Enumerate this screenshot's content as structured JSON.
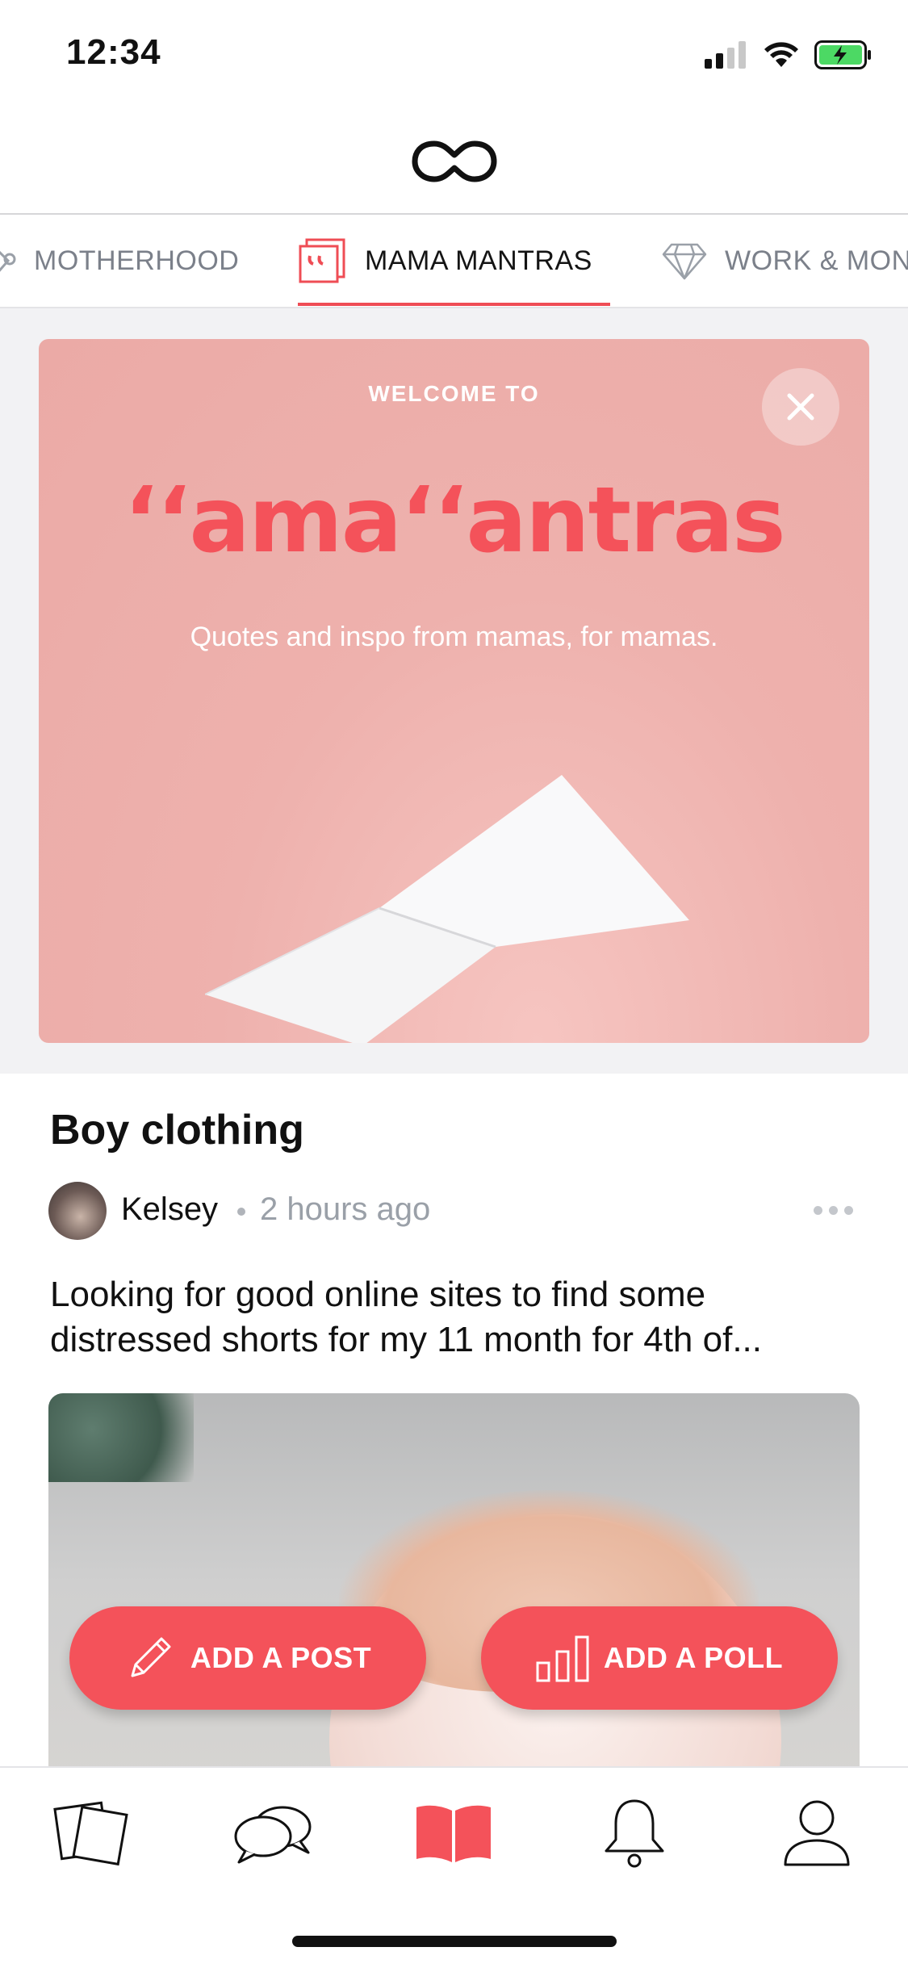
{
  "status_bar": {
    "time": "12:34"
  },
  "tabs": [
    {
      "label": "MOTHERHOOD",
      "icon": "baby-rattle-icon"
    },
    {
      "label": "MAMA MANTRAS",
      "icon": "quote-icon",
      "active": true
    },
    {
      "label": "WORK & MON",
      "icon": "diamond-icon"
    }
  ],
  "banner": {
    "welcome": "WELCOME TO",
    "brand": "ʻʻamaʻʻantras",
    "tagline": "Quotes and inspo from mamas, for mamas."
  },
  "post": {
    "title": "Boy clothing",
    "author": "Kelsey",
    "time": "2 hours ago",
    "body": "Looking for good online sites to find some distressed shorts for my 11 month for 4th of..."
  },
  "actions": {
    "add_post": "ADD A POST",
    "add_poll": "ADD A POLL"
  },
  "colors": {
    "accent": "#f4525a",
    "banner_bg": "#ebaaa6",
    "muted_text": "#7b808a"
  },
  "bottom_nav": [
    {
      "icon": "cards-icon"
    },
    {
      "icon": "chat-bubbles-icon"
    },
    {
      "icon": "book-icon",
      "active": true
    },
    {
      "icon": "bell-icon"
    },
    {
      "icon": "profile-icon"
    }
  ]
}
